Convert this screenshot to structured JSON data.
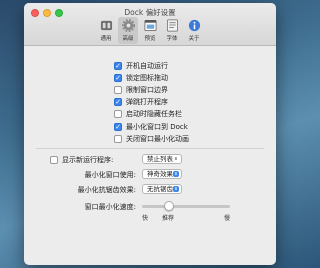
{
  "window": {
    "title": "Dock 偏好设置"
  },
  "toolbar": {
    "items": [
      {
        "label": "通用",
        "icon": "switch-icon"
      },
      {
        "label": "高级",
        "icon": "gear-icon"
      },
      {
        "label": "预览",
        "icon": "preview-icon"
      },
      {
        "label": "字体",
        "icon": "font-icon"
      },
      {
        "label": "关于",
        "icon": "info-icon"
      }
    ],
    "active": "高级"
  },
  "options": [
    {
      "label": "开机自动运行",
      "checked": true
    },
    {
      "label": "锁定图标拖动",
      "checked": true
    },
    {
      "label": "限制窗口边界",
      "checked": false
    },
    {
      "label": "弹跳打开程序",
      "checked": true
    },
    {
      "label": "启动时隐藏任务栏",
      "checked": false
    },
    {
      "label": "最小化窗口到 Dock",
      "checked": true
    },
    {
      "label": "关闭窗口最小化动画",
      "checked": false
    }
  ],
  "settings": {
    "show_new_app": {
      "label": "显示新运行程序:",
      "checked": false,
      "value": "禁止列表"
    },
    "minimize_effect": {
      "label": "最小化窗口使用:",
      "value": "神奇效果"
    },
    "minimize_anim": {
      "label": "最小化抗锯齿效果:",
      "value": "无抗锯齿"
    },
    "minimize_speed": {
      "label": "窗口最小化速度:",
      "min_label": "快",
      "mid_label": "推荐",
      "max_label": "慢",
      "value_fraction": 0.27
    }
  },
  "colors": {
    "accent": "#3b86ed"
  }
}
